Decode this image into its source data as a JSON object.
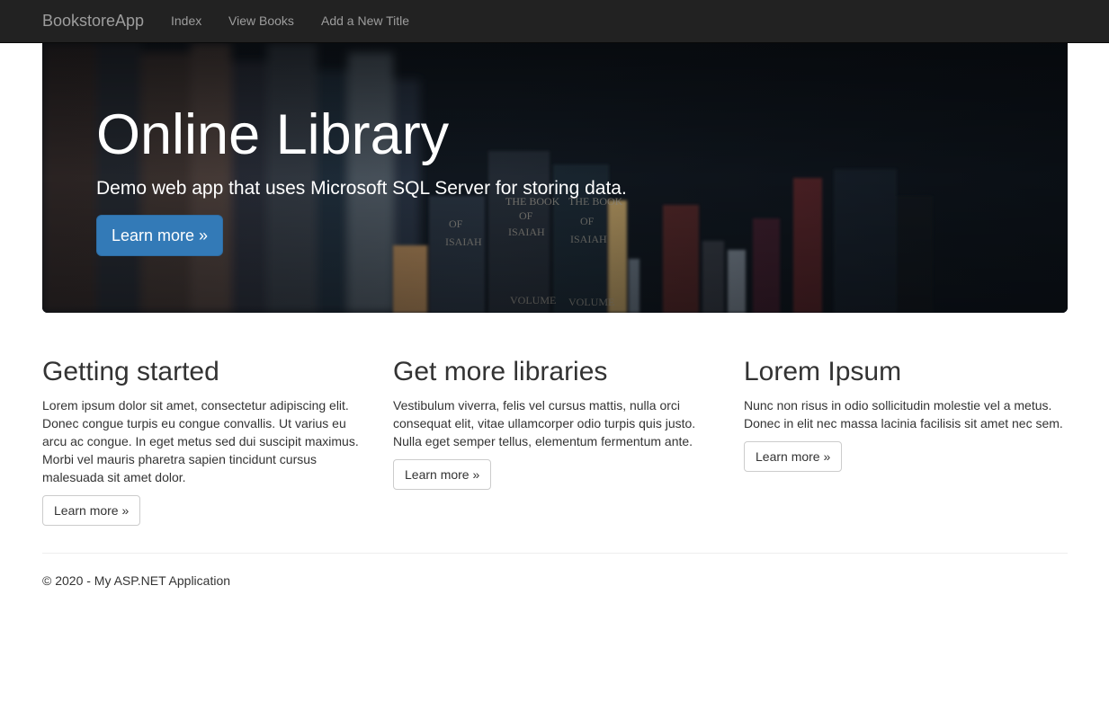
{
  "navbar": {
    "brand": "BookstoreApp",
    "links": [
      "Index",
      "View Books",
      "Add a New Title"
    ]
  },
  "jumbotron": {
    "title": "Online Library",
    "lead": "Demo web app that uses Microsoft SQL Server for storing data.",
    "button_label": "Learn more »"
  },
  "columns": [
    {
      "heading": "Getting started",
      "text": "Lorem ipsum dolor sit amet, consectetur adipiscing elit. Donec congue turpis eu congue convallis. Ut varius eu arcu ac congue. In eget metus sed dui suscipit maximus. Morbi vel mauris pharetra sapien tincidunt cursus malesuada sit amet dolor.",
      "button_label": "Learn more »"
    },
    {
      "heading": "Get more libraries",
      "text": "Vestibulum viverra, felis vel cursus mattis, nulla orci consequat elit, vitae ullamcorper odio turpis quis justo. Nulla eget semper tellus, elementum fermentum ante.",
      "button_label": "Learn more »"
    },
    {
      "heading": "Lorem Ipsum",
      "text": "Nunc non risus in odio sollicitudin molestie vel a metus. Donec in elit nec massa lacinia facilisis sit amet nec sem.",
      "button_label": "Learn more »"
    }
  ],
  "footer": {
    "text": "© 2020 - My ASP.NET Application"
  },
  "colors": {
    "navbar_bg": "#222222",
    "navbar_text": "#9d9d9d",
    "primary": "#337ab7",
    "text": "#333333"
  }
}
